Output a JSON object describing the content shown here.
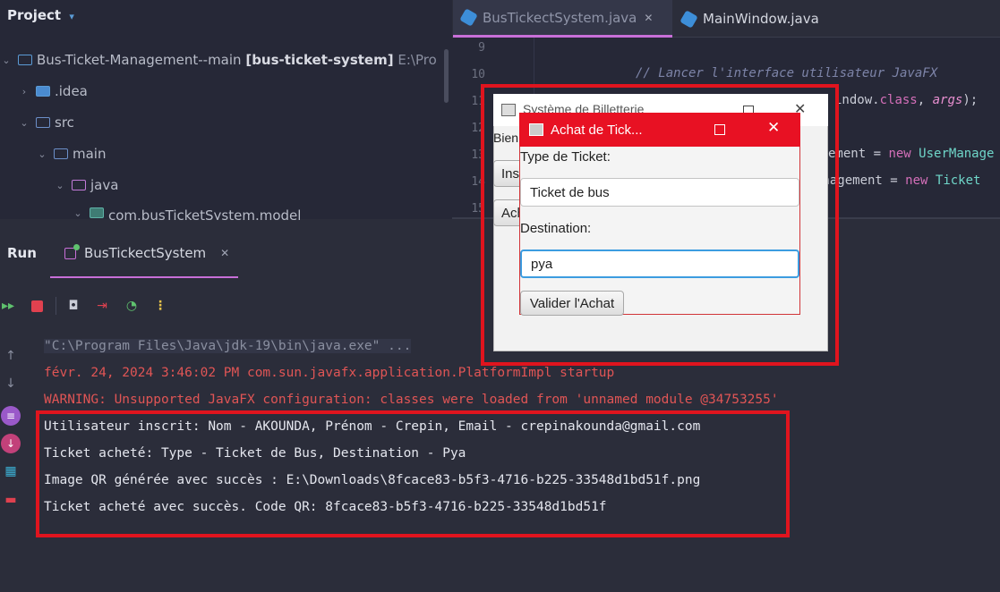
{
  "project": {
    "header": "Project",
    "tree": [
      {
        "label": "Bus-Ticket-Management--main",
        "module": "[bus-ticket-system]",
        "path": "E:\\Pro"
      },
      {
        "label": ".idea"
      },
      {
        "label": "src"
      },
      {
        "label": "main"
      },
      {
        "label": "java"
      },
      {
        "label": "com.busTicketSystem.model"
      }
    ]
  },
  "editor": {
    "tabs": [
      {
        "label": "BusTickectSystem.java",
        "close": "✕"
      },
      {
        "label": "MainWindow.java"
      }
    ],
    "line_numbers": [
      "9",
      "10",
      "11",
      "12",
      "13",
      "14",
      "15"
    ],
    "code": {
      "line10_comment": "// Lancer l'interface utilisateur JavaFX",
      "line11_a": "indow",
      "line11_b": ".",
      "line11_c": "class",
      "line11_d": ", ",
      "line11_e": "args",
      "line11_f": ");",
      "line13_a": "ement = ",
      "line13_b": "new",
      "line13_c": "UserManage",
      "line14_a": "anagement = ",
      "line14_b": "new",
      "line14_c": "Ticket"
    }
  },
  "run": {
    "title": "Run",
    "tab_label": "BusTickectSystem",
    "tab_close": "✕",
    "console": [
      "\"C:\\Program Files\\Java\\jdk-19\\bin\\java.exe\" ...",
      "févr. 24, 2024 3:46:02 PM com.sun.javafx.application.PlatformImpl startup",
      "WARNING: Unsupported JavaFX configuration: classes were loaded from 'unnamed module @34753255'",
      "Utilisateur inscrit: Nom - AKOUNDA, Prénom - Crepin, Email - crepinakounda@gmail.com",
      "Ticket acheté: Type - Ticket de Bus, Destination - Pya",
      "Image QR générée avec succès : E:\\Downloads\\8fcace83-b5f3-4716-b225-33548d1bd51f.png",
      "Ticket acheté avec succès. Code QR: 8fcace83-b5f3-4716-b225-33548d1bd51f"
    ]
  },
  "back_window": {
    "title": "Système de Billetterie",
    "welcome": "Bien",
    "btn1": "Ins",
    "btn2": "Ach"
  },
  "dialog": {
    "title": "Achat de Tick...",
    "type_label": "Type de Ticket:",
    "type_value": "Ticket de bus",
    "destination_label": "Destination:",
    "destination_value": "pya",
    "submit": "Valider l'Achat"
  },
  "colors": {
    "accent": "#c86fd8",
    "annotation_red": "#e0141e",
    "dialog_title": "#e81123"
  }
}
